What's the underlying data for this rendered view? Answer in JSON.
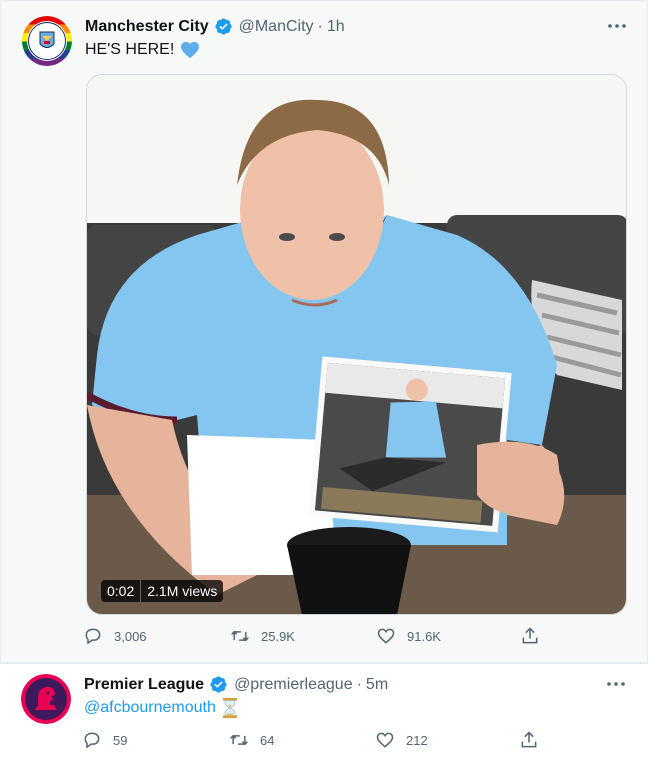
{
  "tweets": [
    {
      "author_name": "Manchester City",
      "handle": "@ManCity",
      "separator": "·",
      "time": "1h",
      "text": "HE'S HERE!",
      "text_emoji": "blue-heart-icon",
      "media": {
        "type": "video",
        "duration": "0:02",
        "views": "2.1M views",
        "description_icon": "video-thumbnail"
      },
      "stats": {
        "replies": "3,006",
        "retweets": "25.9K",
        "likes": "91.6K"
      },
      "verified": true
    },
    {
      "author_name": "Premier League",
      "handle": "@premierleague",
      "separator": "·",
      "time": "5m",
      "text": "@afcbournemouth",
      "text_emoji": "hourglass-icon",
      "stats": {
        "replies": "59",
        "retweets": "64",
        "likes": "212"
      },
      "verified": true
    }
  ],
  "colors": {
    "accent": "#1d9bf0",
    "muted": "#536471",
    "thread_line": "#cfd9de",
    "highlight_bg": "#f7f9f9"
  }
}
